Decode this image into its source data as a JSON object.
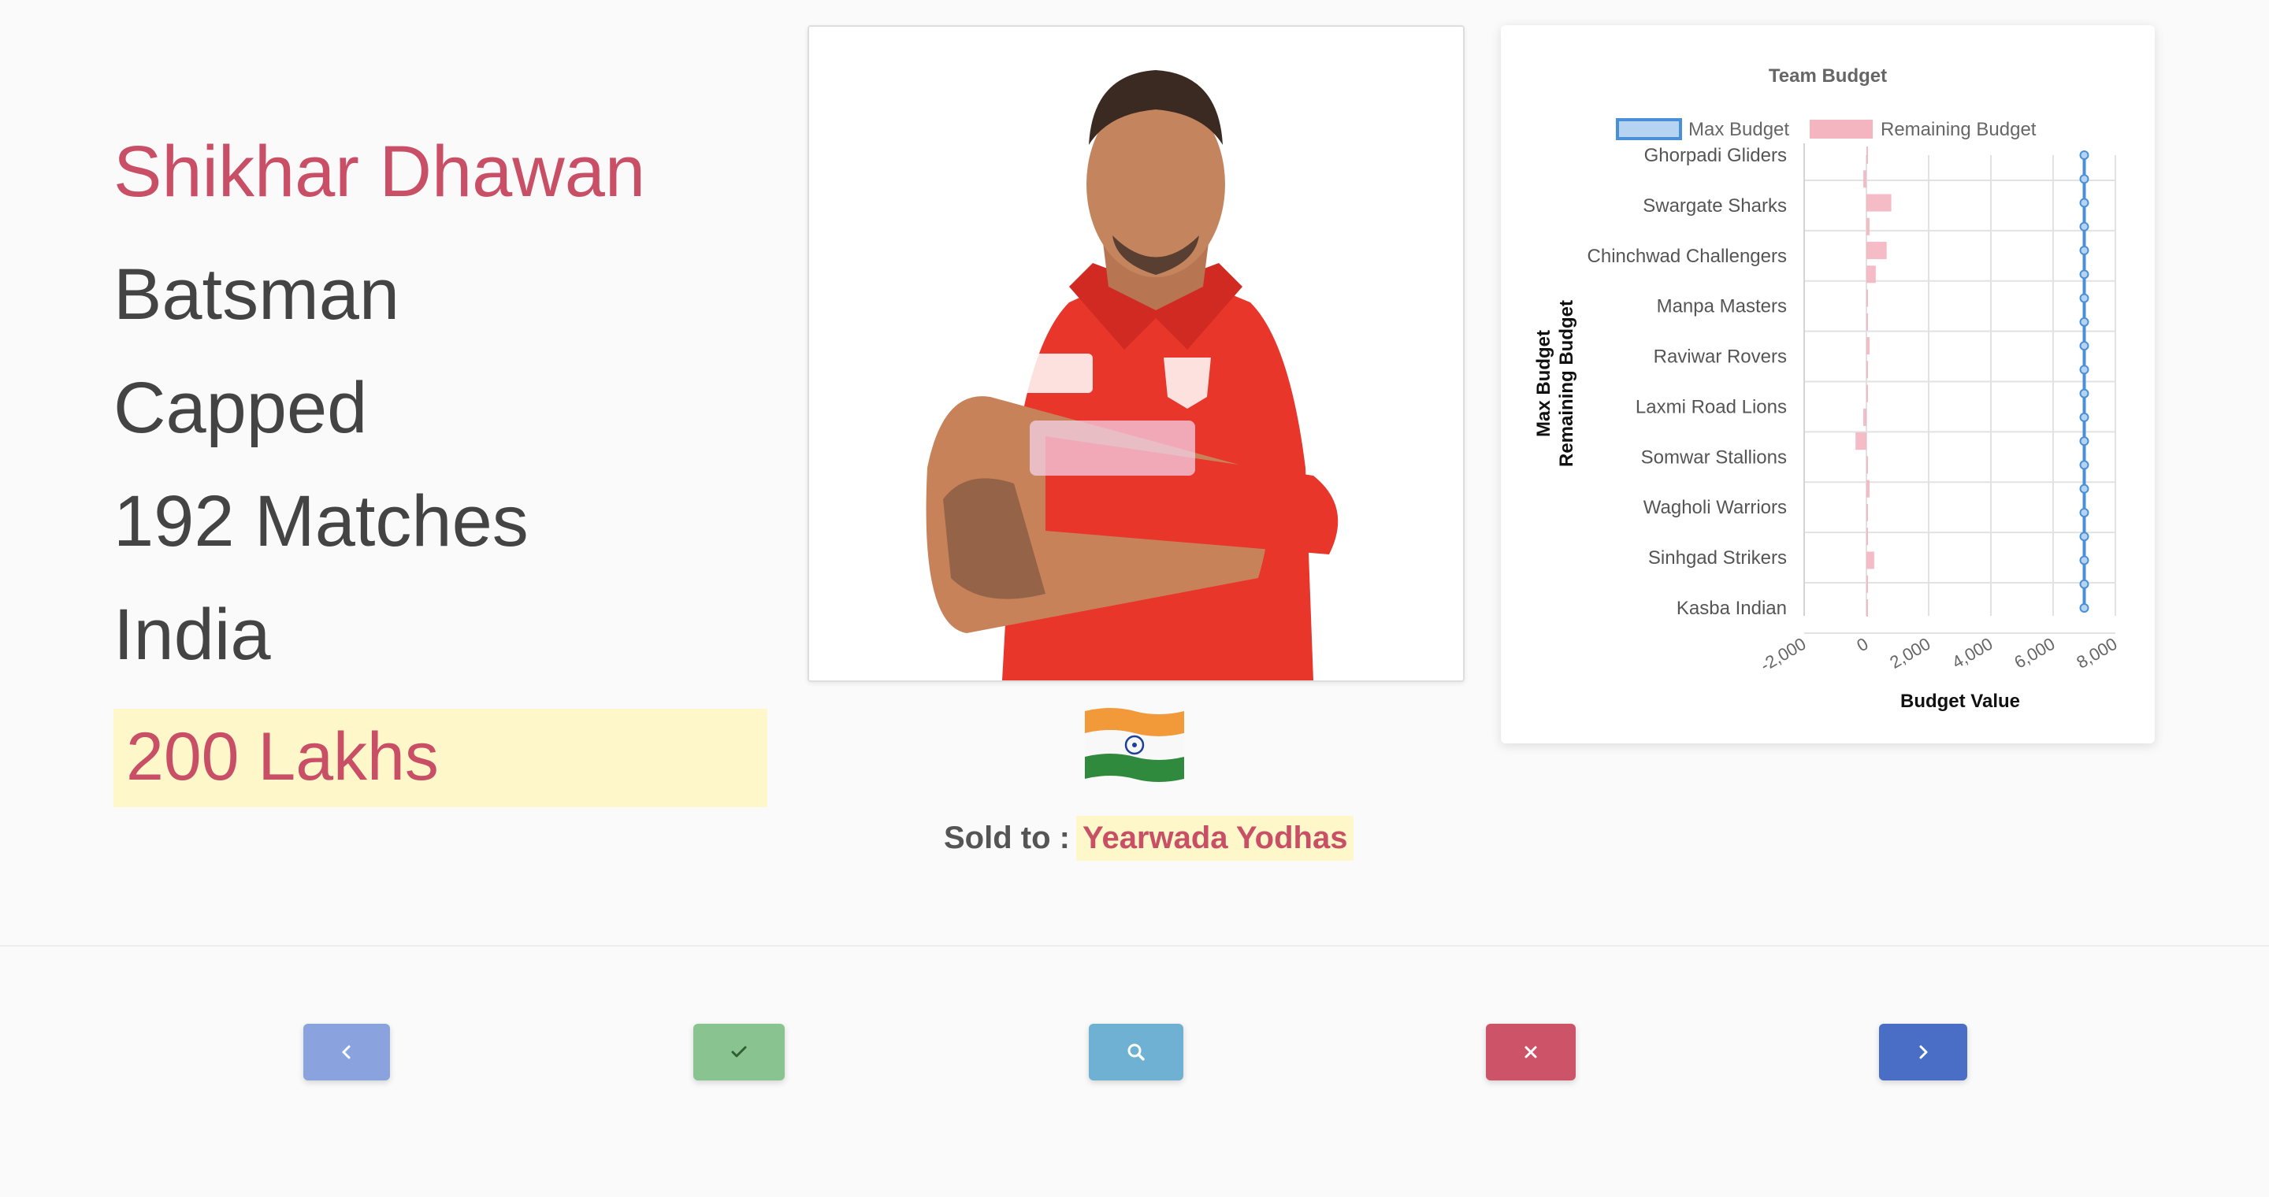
{
  "player": {
    "name": "Shikhar Dhawan",
    "role": "Batsman",
    "status": "Capped",
    "matches": "192 Matches",
    "country": "India",
    "price": "200 Lakhs"
  },
  "sale": {
    "label": "Sold to :",
    "team": "Yearwada Yodhas"
  },
  "colors": {
    "accent": "#c94f66",
    "highlight": "#fdf7c9",
    "prev_button": "#8aa3de",
    "sold_button": "#88c390",
    "search_button": "#6fb1d3",
    "unsold_button": "#cd5468",
    "next_button": "#4a6ec6"
  },
  "buttons": [
    {
      "icon": "chevron-left-icon"
    },
    {
      "icon": "check-icon"
    },
    {
      "icon": "search-icon"
    },
    {
      "icon": "close-icon"
    },
    {
      "icon": "chevron-right-icon"
    }
  ],
  "chart_data": {
    "type": "bar",
    "orientation": "horizontal",
    "title": "Team Budget",
    "xlabel": "Budget Value",
    "ylabel": "Max Budget\nRemaining Budget",
    "categories": [
      "Ghorpadi Gliders",
      "Swargate Sharks",
      "Chinchwad Challengers",
      "Manpa Masters",
      "Raviwar Rovers",
      "Laxmi Road Lions",
      "Somwar Stallions",
      "Wagholi Warriors",
      "Sinhgad Strikers",
      "Kasba Indian"
    ],
    "xticks": [
      "-2,000",
      "0",
      "2,000",
      "4,000",
      "6,000",
      "8,000"
    ],
    "xlim": [
      -2000,
      8000
    ],
    "legend": "top",
    "grid": true,
    "series": [
      {
        "name": "Max Budget",
        "color": "#4a90d9",
        "render": "line",
        "values": [
          7000,
          7000,
          7000,
          7000,
          7000,
          7000,
          7000,
          7000,
          7000,
          7000,
          7000,
          7000,
          7000,
          7000,
          7000,
          7000,
          7000,
          7000,
          7000,
          7000
        ]
      },
      {
        "name": "Remaining Budget",
        "color": "#f4b4c0",
        "render": "bar",
        "values": [
          0,
          -100,
          800,
          100,
          650,
          300,
          0,
          0,
          100,
          0,
          0,
          -100,
          -350,
          0,
          100,
          0,
          50,
          250,
          0,
          0
        ]
      }
    ]
  }
}
